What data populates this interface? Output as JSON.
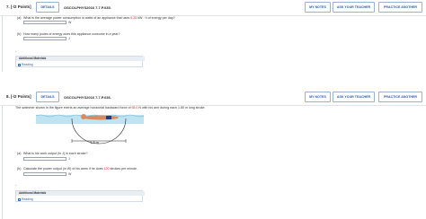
{
  "q1": {
    "number": "7.",
    "points": "[-/2 Points]",
    "details": "DETAILS",
    "code": "OSCOLPHYS2016 7.7.P.035.",
    "my_notes": "MY NOTES",
    "ask_teacher": "ASK YOUR TEACHER",
    "practice": "PRACTICE ANOTHER",
    "part_a_label": "(a)",
    "part_a_text_before": "What is the average power consumption in watts of an appliance that uses ",
    "part_a_value": "6.25",
    "part_a_text_after": " kW · h of energy per day?",
    "part_a_unit": "W",
    "part_b_label": "(b)",
    "part_b_text": "How many joules of energy does this appliance consume in a year?",
    "part_b_unit": "J",
    "additional_materials": "Additional Materials",
    "reading": "Reading"
  },
  "q2": {
    "number": "8.",
    "points": "[-/2 Points]",
    "details": "DETAILS",
    "code": "OSCOLPHYS2016 7.7.P.036.",
    "my_notes": "MY NOTES",
    "ask_teacher": "ASK YOUR TEACHER",
    "practice": "PRACTICE ANOTHER",
    "intro_before": "The swimmer shown in the figure exerts an average horizontal backward force of ",
    "force_value": "65.0",
    "intro_after": " N with his arm during each 1.80 m long stroke.",
    "figure_label": "1.8 m",
    "part_a_label": "(a)",
    "part_a_text": "What is his work output (in J) in each stroke?",
    "part_a_unit": "J",
    "part_b_label": "(b)",
    "part_b_text_before": "Calculate the power output (in W) of his arms if he does ",
    "part_b_value": "120",
    "part_b_text_after": " strokes per minute.",
    "part_b_unit": "W",
    "additional_materials": "Additional Materials",
    "reading": "Reading"
  },
  "colors": {
    "link_blue": "#2e5aa8",
    "highlight_red": "#cc2b2b",
    "water": "#bfe3f0"
  }
}
